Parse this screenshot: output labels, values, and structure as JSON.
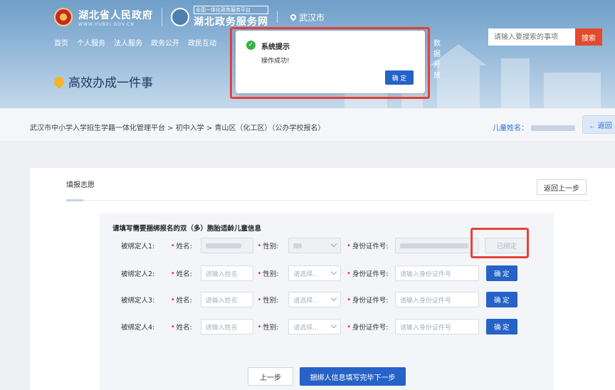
{
  "header": {
    "gov_name": "湖北省人民政府",
    "gov_site": "WWW.HUBEI.GOV.CN",
    "portal_tag": "全国一体化政务服务平台",
    "portal_name": "湖北政务服务网",
    "city": "武汉市",
    "nav": [
      "首页",
      "个人服务",
      "法人服务",
      "政务公开",
      "政民互动"
    ],
    "nav_hidden_tail": "数据开放",
    "search_placeholder": "请输入要搜索的事项",
    "search_button": "搜索",
    "page_heading": "高效办成一件事"
  },
  "breadcrumb": {
    "path": "武汉市中小学入学招生学籍一体化管理平台 > 初中入学 > 青山区（化工区）（公办学校报名）",
    "child_label": "儿童姓名：",
    "back_label": "返回"
  },
  "card": {
    "title": "填报志愿",
    "back_step": "返回上一步",
    "form_heading": "请填写需要捆绑报名的双（多）胞胎适龄儿童信息",
    "name_label": "姓名:",
    "gender_label": "性别:",
    "id_label": "身份证件号:",
    "rows": [
      {
        "label": "被绑定人1:",
        "name_ph": "",
        "gender_ph": "",
        "id_ph": "",
        "button": "已绑定",
        "bound": true
      },
      {
        "label": "被绑定人2:",
        "name_ph": "请输入姓名",
        "gender_ph": "请选择...",
        "id_ph": "请输入身份证件号",
        "button": "确 定",
        "bound": false
      },
      {
        "label": "被绑定人3:",
        "name_ph": "请输入姓名",
        "gender_ph": "请选择...",
        "id_ph": "请输入身份证件号",
        "button": "确 定",
        "bound": false
      },
      {
        "label": "被绑定人4:",
        "name_ph": "请输入姓名",
        "gender_ph": "请选择...",
        "id_ph": "请输入身份证件号",
        "button": "确 定",
        "bound": false
      }
    ],
    "prev_button": "上一步",
    "next_button": "捆绑人信息填写完毕下一步"
  },
  "dialog": {
    "title": "系统提示",
    "message": "操作成功!",
    "ok": "确 定"
  },
  "colors": {
    "primary": "#2662c7",
    "highlight": "#e8413a",
    "success": "#36b24a",
    "search": "#e34a2c"
  }
}
